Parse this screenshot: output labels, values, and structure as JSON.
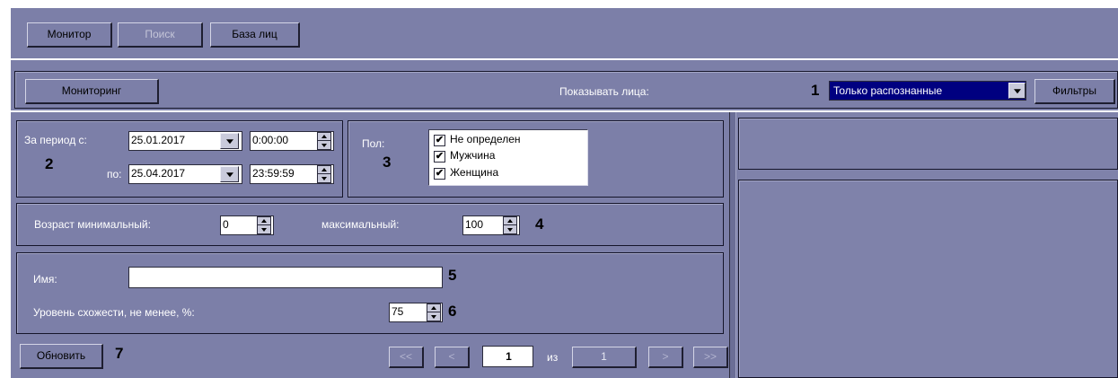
{
  "top_tabs": {
    "monitor": "Монитор",
    "search": "Поиск",
    "face_db": "База лиц"
  },
  "toolbar": {
    "monitoring_button": "Мониторинг",
    "show_faces_label": "Показывать лица:",
    "show_faces_value": "Только распознанные",
    "filters_button": "Фильтры"
  },
  "period": {
    "from_label": "За период с:",
    "to_label": "по:",
    "from_date": "25.01.2017",
    "from_time": "0:00:00",
    "to_date": "25.04.2017",
    "to_time": "23:59:59"
  },
  "gender": {
    "label": "Пол:",
    "options": [
      {
        "label": "Не определен",
        "checked": "✔"
      },
      {
        "label": "Мужчина",
        "checked": "✔"
      },
      {
        "label": "Женщина",
        "checked": "✔"
      }
    ]
  },
  "age": {
    "min_label": "Возраст минимальный:",
    "min_value": "0",
    "max_label": "максимальный:",
    "max_value": "100"
  },
  "name": {
    "label": "Имя:",
    "value": ""
  },
  "similarity": {
    "label": "Уровень схожести, не менее, %:",
    "value": "75"
  },
  "bottom": {
    "refresh_button": "Обновить",
    "first": "<<",
    "prev": "<",
    "page": "1",
    "of_label": "из",
    "total": "1",
    "next": ">",
    "last": ">>"
  },
  "markers": {
    "m1": "1",
    "m2": "2",
    "m3": "3",
    "m4": "4",
    "m5": "5",
    "m6": "6",
    "m7": "7"
  },
  "colors": {
    "panel": "#7c7fa8",
    "selection": "#000080"
  }
}
